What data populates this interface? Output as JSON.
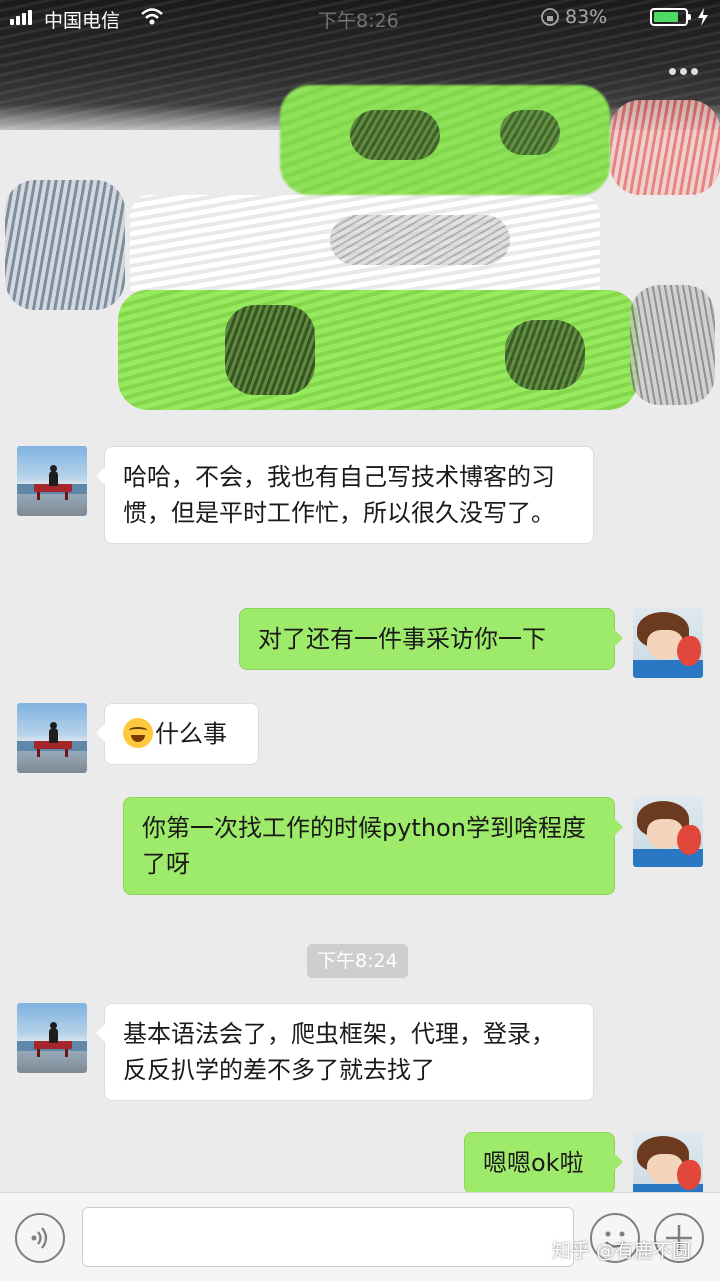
{
  "status_bar": {
    "carrier": "中国电信",
    "time": "下午8:26",
    "battery": "83%"
  },
  "chat": {
    "timestamp": "下午8:24",
    "messages": [
      {
        "from": "contact",
        "text": "哈哈，不会，我也有自己写技术博客的习惯，但是平时工作忙，所以很久没写了。"
      },
      {
        "from": "self",
        "text": "对了还有一件事采访你一下"
      },
      {
        "from": "contact",
        "emoji": "crying-laughing-emoji",
        "text": "什么事"
      },
      {
        "from": "self",
        "text": "你第一次找工作的时候python学到啥程度了呀"
      },
      {
        "from": "contact",
        "text": "基本语法会了，爬虫框架，代理，登录，反反扒学的差不多了就去找了"
      },
      {
        "from": "self",
        "text": "嗯嗯ok啦"
      }
    ]
  },
  "input_bar": {
    "message_value": ""
  },
  "watermark": "知乎 @有鹿不圆",
  "colors": {
    "background": "#ebebeb",
    "incoming_bubble": "#ffffff",
    "outgoing_bubble": "#9eea6a",
    "timestamp_bg": "#cecece"
  },
  "icons": {
    "status": [
      "signal-icon",
      "wifi-icon",
      "lock-rotation-icon",
      "battery-icon",
      "charging-icon"
    ],
    "header": [
      "more-menu-icon"
    ],
    "input": [
      "voice-icon",
      "emoji-icon",
      "plus-icon"
    ]
  }
}
